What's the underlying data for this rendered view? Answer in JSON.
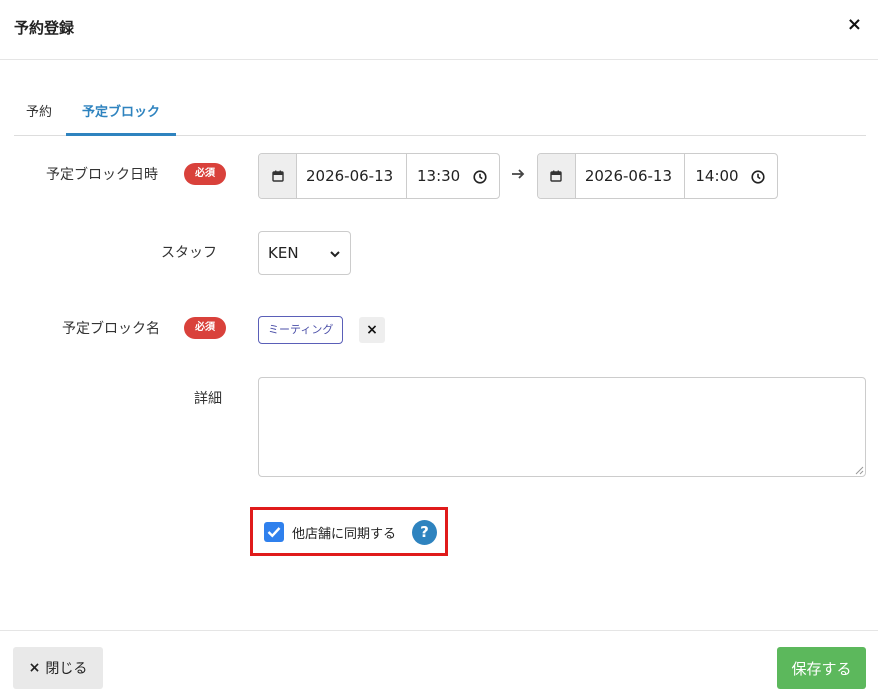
{
  "modal": {
    "title": "予約登録",
    "close_glyph": "×"
  },
  "tabs": [
    {
      "label": "予約",
      "active": false
    },
    {
      "label": "予定ブロック",
      "active": true
    }
  ],
  "form": {
    "datetime": {
      "label": "予定ブロック日時",
      "required_badge": "必須",
      "start_date": "2026-06-13",
      "start_time": "13:30",
      "end_date": "2026-06-13",
      "end_time": "14:00"
    },
    "staff": {
      "label": "スタッフ",
      "selected": "KEN"
    },
    "block_name": {
      "label": "予定ブロック名",
      "required_badge": "必須",
      "chip": "ミーティング",
      "remove_glyph": "×"
    },
    "details": {
      "label": "詳細",
      "value": ""
    },
    "sync": {
      "label": "他店舗に同期する",
      "checked": true,
      "help_glyph": "?"
    }
  },
  "footer": {
    "close_button": "閉じる",
    "close_glyph": "×",
    "save_button": "保存する"
  },
  "colors": {
    "accent": "#2e83bf",
    "required": "#d9413b",
    "save": "#5cb85c",
    "highlight": "#e01b1b",
    "checkbox": "#2f80ed"
  }
}
